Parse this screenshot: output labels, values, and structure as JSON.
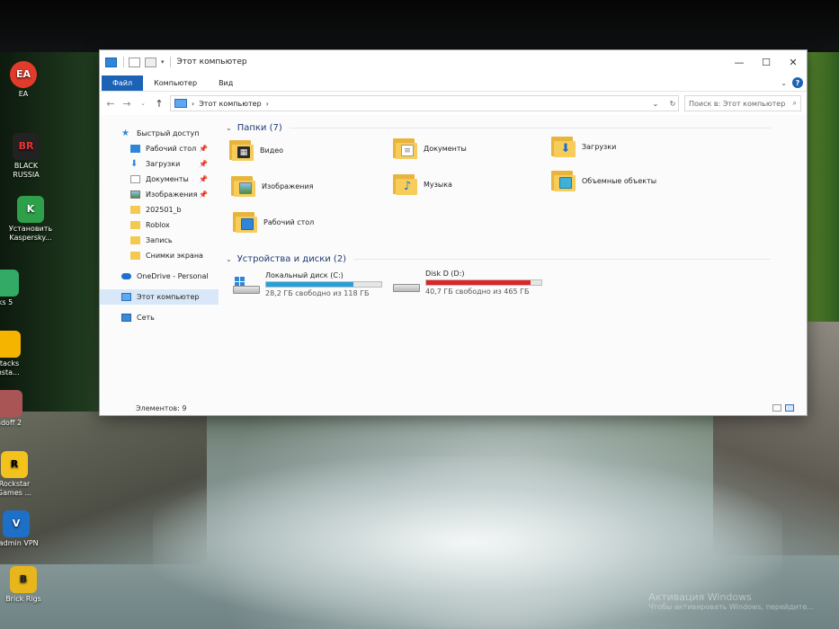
{
  "window": {
    "title": "Этот компьютер",
    "controls": [
      "—",
      "☐",
      "✕"
    ]
  },
  "ribbon": {
    "tabs": [
      "Файл",
      "Компьютер",
      "Вид"
    ],
    "help": "?"
  },
  "address": {
    "path": "Этот компьютер",
    "sep": "›",
    "search_placeholder": "Поиск в: Этот компьютер"
  },
  "nav": {
    "quick_access": "Быстрый доступ",
    "quick_items": [
      "Рабочий стол",
      "Загрузки",
      "Документы",
      "Изображения"
    ],
    "folders": [
      "202501_b",
      "Roblox",
      "Запись",
      "Снимки экрана"
    ],
    "onedrive": "OneDrive - Personal",
    "this_pc": "Этот компьютер",
    "network": "Сеть"
  },
  "groups": {
    "folders_header": "Папки (7)",
    "devices_header": "Устройства и диски (2)"
  },
  "folders": [
    "Видео",
    "Документы",
    "Загрузки",
    "Изображения",
    "Музыка",
    "Объемные объекты",
    "Рабочий стол"
  ],
  "drives": [
    {
      "name": "Локальный диск (C:)",
      "free": "28,2 ГБ свободно из 118 ГБ",
      "used_fraction": 0.76,
      "bar_color": "#26a0da"
    },
    {
      "name": "Disk D (D:)",
      "free": "40,7 ГБ свободно из 465 ГБ",
      "used_fraction": 0.91,
      "bar_color": "#da2626"
    }
  ],
  "status": {
    "items": "Элементов: 9"
  },
  "desktop": {
    "icons": [
      "EA",
      "BLACK RUSSIA",
      "Установить Kaspersky...",
      "ks 5",
      "Stacks Insta...",
      "ndoff 2",
      "Rockstar Games ...",
      "Radmin VPN",
      "Brick Rigs"
    ],
    "activation_title": "Активация Windows",
    "activation_sub": "Чтобы активировать Windows, перейдите..."
  }
}
